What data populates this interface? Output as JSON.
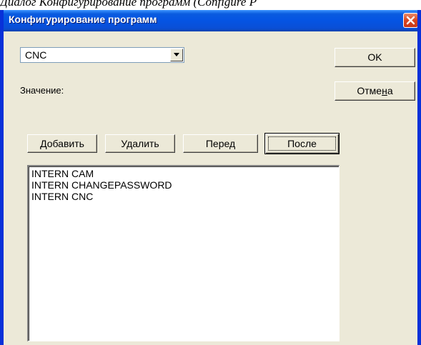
{
  "document": {
    "caption_fragment": "Диалог Конфигурирование программ (Configure P"
  },
  "dialog": {
    "title": "Конфигурирование программ",
    "program_select": {
      "value": "CNC"
    },
    "value_label": "Значение:",
    "ok_label": "OK",
    "cancel_label": {
      "before": "Отме",
      "underlined": "н",
      "after": "а"
    },
    "actions": {
      "add_label": "Добавить",
      "delete_label": "Удалить",
      "before_label": "Перед",
      "after_label": "После"
    },
    "entries": [
      "INTERN CAM",
      "INTERN CHANGEPASSWORD",
      "INTERN CNC"
    ]
  },
  "colors": {
    "titlebar": "#0554e3",
    "window_face": "#ece9d8",
    "close_button": "#d9451e"
  },
  "icons": {
    "close": "close-icon",
    "dropdown": "chevron-down-icon"
  }
}
